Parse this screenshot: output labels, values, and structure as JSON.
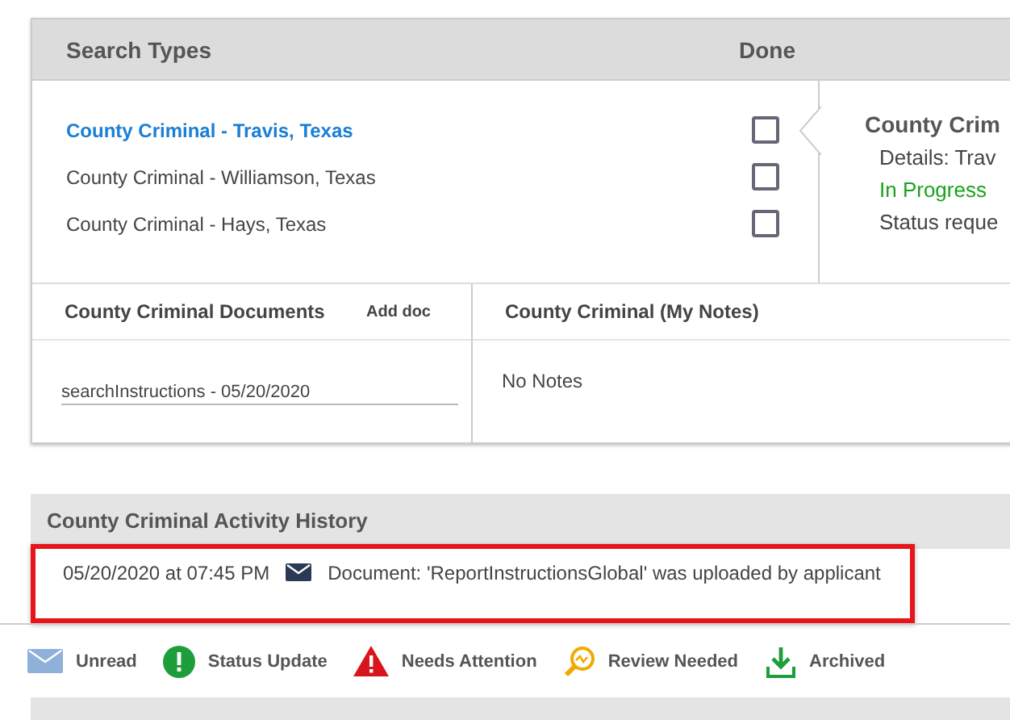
{
  "search_types": {
    "header": "Search Types",
    "done_header": "Done",
    "items": [
      {
        "label": "County Criminal - Travis, Texas",
        "selected": true,
        "checked": false
      },
      {
        "label": "County Criminal - Williamson, Texas",
        "selected": false,
        "checked": false
      },
      {
        "label": "County Criminal - Hays, Texas",
        "selected": false,
        "checked": false
      }
    ]
  },
  "detail": {
    "title": "County Crim",
    "details": "Details: Trav",
    "status": "In Progress",
    "status_request": "Status reque"
  },
  "documents": {
    "title": "County Criminal Documents",
    "add_link": "Add doc",
    "items": [
      "searchInstructions - 05/20/2020"
    ]
  },
  "notes": {
    "title": "County Criminal (My Notes)",
    "text": "No Notes"
  },
  "activity": {
    "title": "County Criminal Activity History",
    "entries": [
      {
        "time": "05/20/2020 at 07:45 PM",
        "text": "Document: 'ReportInstructionsGlobal' was uploaded by applicant",
        "highlighted": true
      }
    ]
  },
  "legend": [
    {
      "kind": "unread",
      "label": "Unread"
    },
    {
      "kind": "status",
      "label": "Status Update"
    },
    {
      "kind": "attention",
      "label": "Needs Attention"
    },
    {
      "kind": "review",
      "label": "Review Needed"
    },
    {
      "kind": "archived",
      "label": "Archived"
    }
  ]
}
